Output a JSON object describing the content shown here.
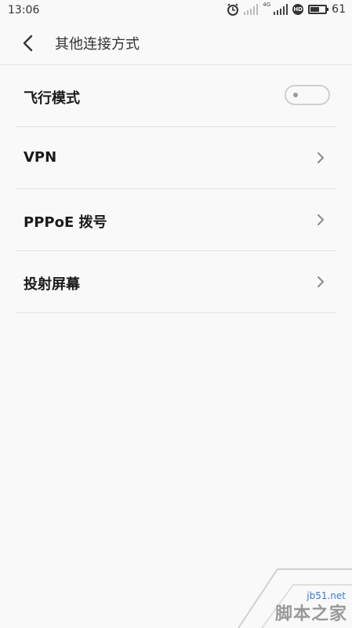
{
  "status_bar": {
    "time": "13:06",
    "network": "4G",
    "hd_label": "HD",
    "battery": "61",
    "battery_level": 0.61
  },
  "header": {
    "title": "其他连接方式",
    "back_icon": "chevron-left-icon"
  },
  "settings": [
    {
      "label": "飞行模式",
      "control": "toggle",
      "on": false
    },
    {
      "label": "VPN",
      "control": "chevron"
    },
    {
      "label": "PPPoE 拨号",
      "control": "chevron"
    },
    {
      "label": "投射屏幕",
      "control": "chevron"
    }
  ],
  "watermark": {
    "url": "jb51.net",
    "text": "脚本之家"
  },
  "colors": {
    "background": "#f9f9f9",
    "divider": "#e2e2e2",
    "text": "#1a1a1a"
  }
}
